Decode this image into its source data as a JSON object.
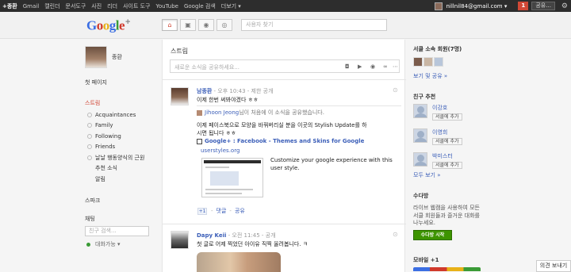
{
  "topbar": {
    "nav": [
      "+종환",
      "Gmail",
      "캘린더",
      "문서도구",
      "사진",
      "리더",
      "사이트 도구",
      "YouTube",
      "Google 검색",
      "더보기 ▾"
    ],
    "email": "nillnil84@gmail.com ▾",
    "notifications": "1",
    "share_label": "공유..."
  },
  "header": {
    "search_placeholder": "사용자 찾기"
  },
  "left": {
    "profile_name": "종환",
    "first_page": "첫 페이지",
    "stream_label": "스트림",
    "circles": [
      "Acquaintances",
      "Family",
      "Following",
      "Friends",
      "날날 행동양식의 근원"
    ],
    "sub_items": [
      "추천 소식",
      "알림"
    ],
    "sparks": "스파크",
    "chat": "채팅",
    "chat_search_placeholder": "친구 검색...",
    "availability": "대화가능 ▾"
  },
  "center": {
    "title": "스트림",
    "share_placeholder": "새로운 소식을 공유하세요...",
    "post1": {
      "author": "남종환",
      "meta": " - 오후 10:43 - 제한 공개",
      "text": "이제 한번 써봐야겠다 ㅎㅎ",
      "reshare_author": "Jihoon Jeong",
      "reshare_note": "님이 처음에 이 소식을 공유했습니다.",
      "reshare_text_1": "이제 페이스북으로 모양을 바꿔버리실 분을 이곳의 Stylish Update를 하",
      "reshare_text_2": "시면 됩니다 ㅎㅎ",
      "link_title": "Google+ : Facebook - Themes and Skins for Google",
      "link_domain": "userstyles.org",
      "link_desc": "Customize your google experience with this user style.",
      "plus_one": "+1",
      "action_comment": "댓글",
      "action_share": "공유"
    },
    "post2": {
      "author": "Dapy Keii",
      "meta": " - 오전 11:45 - 공개",
      "text": "첫 글로 어제 찍었던 아이유 직찍 올려봅니다. ㅋ"
    }
  },
  "right": {
    "circle_header": "서클 소속 회원(7명)",
    "view_share": "보기 및 공유 »",
    "suggest_header": "친구 추천",
    "suggestions": [
      {
        "name": "이강호",
        "button": "서클에 추가"
      },
      {
        "name": "이영희",
        "button": "서클에 추가"
      },
      {
        "name": "박미스터",
        "button": "서클에 추가"
      }
    ],
    "view_all": "모두 보기 »",
    "hangout_header": "수다방",
    "hangout_desc": "라이브 웹캠을 사용하여 모든 서클 회원들과 즐거운 대화를 나누세요.",
    "hangout_button": "수다방 시작",
    "mobile_header": "모바일 +1"
  },
  "feedback": "의견 보내기"
}
